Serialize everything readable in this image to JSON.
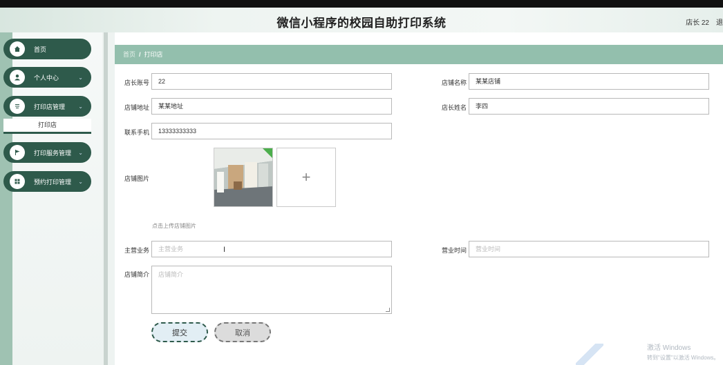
{
  "app": {
    "title": "微信小程序的校园自助打印系统",
    "user": "店长 22",
    "logout": "退"
  },
  "sidebar": {
    "items": [
      {
        "label": "首页",
        "icon": "home-icon",
        "chevron": ""
      },
      {
        "label": "个人中心",
        "icon": "user-icon",
        "chevron": "⌄"
      },
      {
        "label": "打印店管理",
        "icon": "list-icon",
        "chevron": "⌄"
      },
      {
        "label": "打印服务管理",
        "icon": "flag-icon",
        "chevron": "⌄"
      },
      {
        "label": "预约打印管理",
        "icon": "grid-icon",
        "chevron": "⌄"
      }
    ],
    "submenu": "打印店"
  },
  "breadcrumb": {
    "home": "首页",
    "separator": "/",
    "current": "打印店"
  },
  "form": {
    "owner_account": {
      "label": "店长账号",
      "value": "22"
    },
    "shop_name": {
      "label": "店铺名称",
      "value": "某某店铺"
    },
    "shop_address": {
      "label": "店铺地址",
      "value": "某某地址"
    },
    "owner_name": {
      "label": "店长姓名",
      "value": "李四"
    },
    "phone": {
      "label": "联系手机",
      "value": "13333333333"
    },
    "shop_image": {
      "label": "店铺图片",
      "upload_symbol": "+",
      "hint": "点击上传店铺图片"
    },
    "main_business": {
      "label": "主营业务",
      "placeholder": "主营业务"
    },
    "business_hours": {
      "label": "营业时间",
      "placeholder": "营业时间"
    },
    "shop_intro": {
      "label": "店铺简介",
      "placeholder": "店铺简介"
    }
  },
  "buttons": {
    "submit": "提交",
    "cancel": "取消"
  },
  "watermark": {
    "line1": "激活 Windows",
    "line2": "转到\"设置\"以激活 Windows。"
  },
  "colors": {
    "sidebar_item": "#2e5a4b",
    "breadcrumb_bar": "#93bfad",
    "sidebar_accent": "#9fc2b2"
  }
}
